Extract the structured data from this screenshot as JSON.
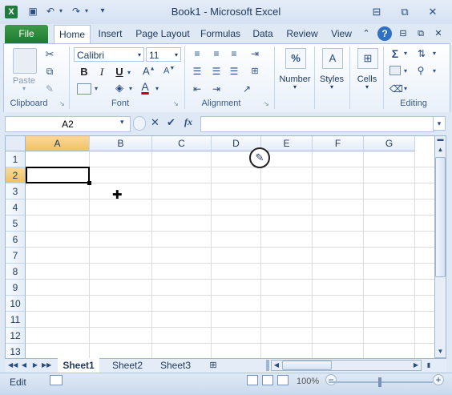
{
  "window": {
    "title": "Book1  -  Microsoft Excel",
    "controls": {
      "minimize": "⊟",
      "restore": "⧉",
      "close": "✕"
    }
  },
  "quick_access": {
    "logo_letter": "X"
  },
  "tabs": [
    {
      "label": "File"
    },
    {
      "label": "Home"
    },
    {
      "label": "Insert"
    },
    {
      "label": "Page Layout"
    },
    {
      "label": "Formulas"
    },
    {
      "label": "Data"
    },
    {
      "label": "Review"
    },
    {
      "label": "View"
    }
  ],
  "ribbon": {
    "clipboard": {
      "paste": "Paste",
      "group": "Clipboard"
    },
    "font": {
      "name": "Calibri",
      "size": "11",
      "bold": "B",
      "italic": "I",
      "underline": "U",
      "font_color": "A",
      "group": "Font"
    },
    "alignment": {
      "group": "Alignment"
    },
    "number": {
      "label": "Number",
      "icon": "%"
    },
    "styles": {
      "label": "Styles"
    },
    "cells": {
      "label": "Cells"
    },
    "editing": {
      "sigma": "Σ",
      "group": "Editing"
    }
  },
  "formula_bar": {
    "name_box": "A2",
    "fx": "fx",
    "value": ""
  },
  "grid": {
    "columns": [
      "A",
      "B",
      "C",
      "D",
      "E",
      "F",
      "G"
    ],
    "rows": [
      "1",
      "2",
      "3",
      "4",
      "5",
      "6",
      "7",
      "8",
      "9",
      "10",
      "11",
      "12",
      "13"
    ],
    "selected_cell": "A2"
  },
  "sheets": [
    {
      "label": "Sheet1"
    },
    {
      "label": "Sheet2"
    },
    {
      "label": "Sheet3"
    }
  ],
  "status": {
    "mode": "Edit",
    "zoom": "100%"
  },
  "colors": {
    "file_tab": "#1e7a2e",
    "selected_header": "#f1c15f",
    "font_color_bar": "#c00000"
  }
}
